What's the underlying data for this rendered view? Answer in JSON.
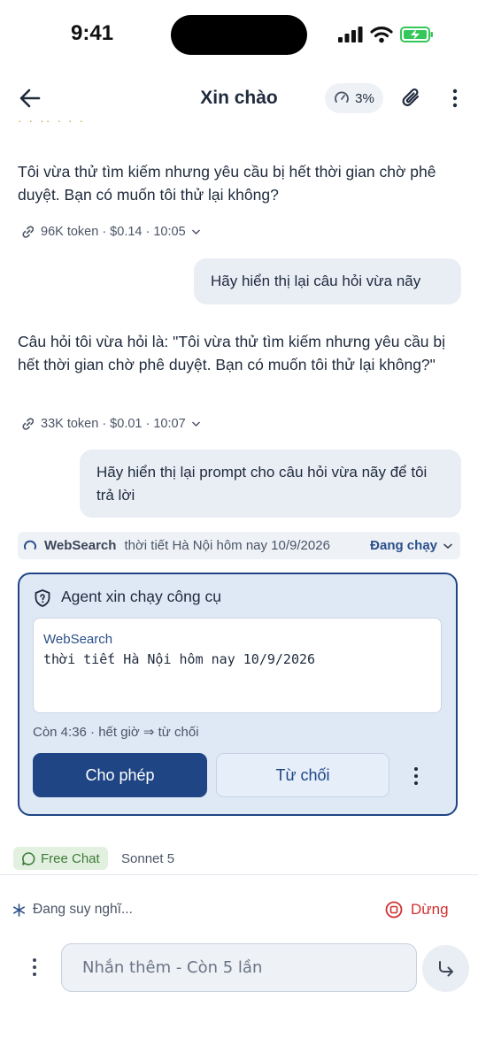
{
  "status_bar": {
    "time": "9:41"
  },
  "header": {
    "title": "Xin chào",
    "usage": "3%"
  },
  "messages": {
    "a1_text": "Tôi vừa thử tìm kiếm nhưng yêu cầu bị hết thời gian chờ phê duyệt. Bạn có muốn tôi thử lại không?",
    "a1_meta": "96K token · $0.14 · 10:05",
    "u1_text": "Hãy hiển thị lại câu hỏi vừa nãy",
    "a2_text": "Câu hỏi tôi vừa hỏi là: \"Tôi vừa thử tìm kiếm nhưng yêu cầu bị hết thời gian chờ phê duyệt. Bạn có muốn tôi thử lại không?\"",
    "a2_meta": "33K token · $0.01 · 10:07",
    "u2_text": "Hãy hiển thị lại prompt cho câu hỏi vừa nãy để tôi trả lời"
  },
  "tool_call": {
    "name": "WebSearch",
    "query": "thời tiết Hà Nội hôm nay 10/9/2026",
    "status": "Đang chạy"
  },
  "approval": {
    "title": "Agent xin chạy công cụ",
    "tool_name": "WebSearch",
    "tool_input": "thời tiết Hà Nội hôm nay 10/9/2026",
    "timer": "Còn 4:36 · hết giờ ⇒ từ chối",
    "allow_label": "Cho phép",
    "deny_label": "Từ chối"
  },
  "mode": {
    "label": "Free Chat",
    "model": "Sonnet 5"
  },
  "footer": {
    "thinking": "Đang suy nghĩ...",
    "stop_label": "Dừng",
    "input_placeholder": "Nhắn thêm - Còn 5 lần"
  },
  "colors": {
    "accent": "#1f4585",
    "stop": "#d0302f",
    "mode_green": "#3e7a3a",
    "battery": "#34c759"
  },
  "icons": [
    "back-arrow-icon",
    "gauge-icon",
    "paperclip-icon",
    "kebab-icon",
    "link-icon",
    "chevron-down-icon",
    "spinner-icon",
    "shield-icon",
    "chat-bubble-icon",
    "asterisk-icon",
    "stop-icon",
    "send-icon",
    "signal-icon",
    "wifi-icon",
    "battery-icon"
  ]
}
